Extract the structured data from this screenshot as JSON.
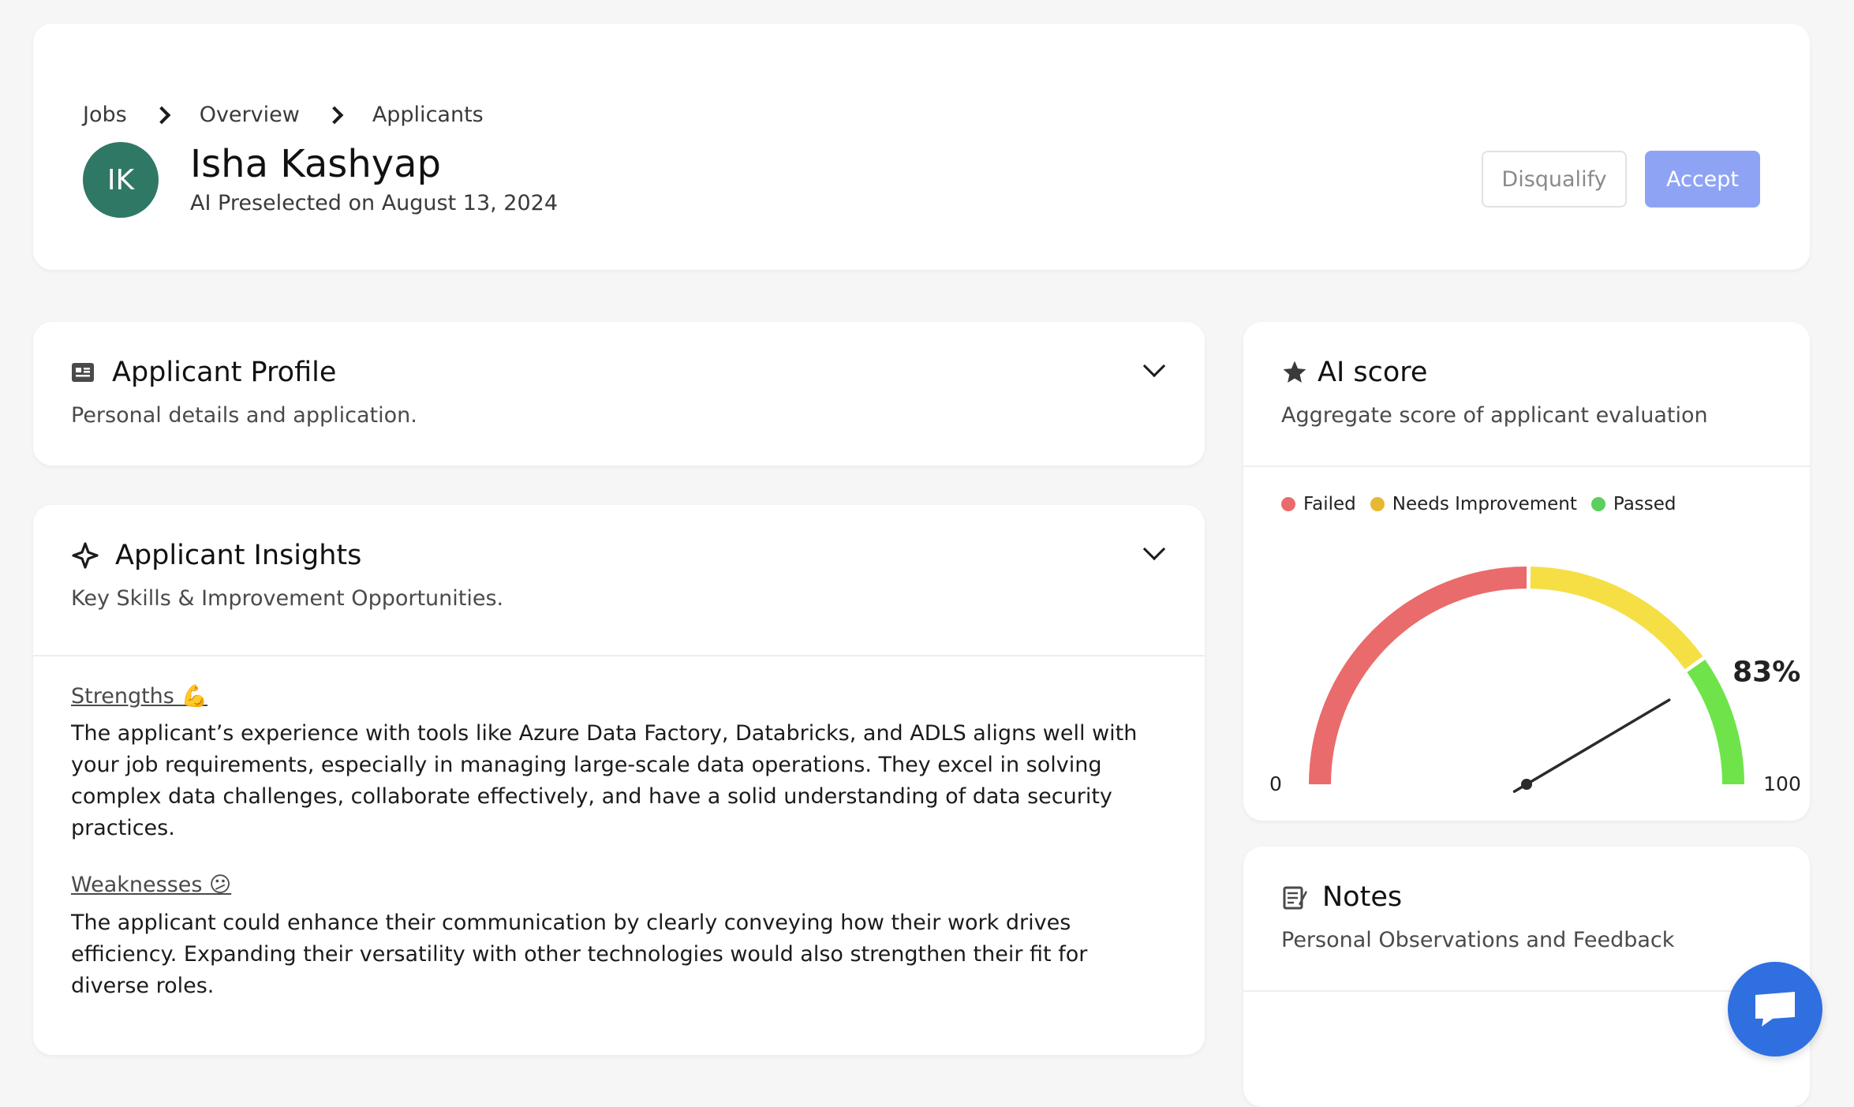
{
  "breadcrumb": [
    "Jobs",
    "Overview",
    "Applicants"
  ],
  "applicant": {
    "initials": "IK",
    "name": "Isha Kashyap",
    "subtitle": "AI Preselected on August 13, 2024",
    "avatar_color": "#2f7866"
  },
  "actions": {
    "disqualify_label": "Disqualify",
    "accept_label": "Accept",
    "accept_color": "#8fa3f5"
  },
  "profile_card": {
    "icon": "id-card-icon",
    "title": "Applicant Profile",
    "subtitle": "Personal details and application."
  },
  "insights_card": {
    "icon": "sparkle-icon",
    "title": "Applicant Insights",
    "subtitle": "Key Skills & Improvement Opportunities.",
    "strengths_title": "Strengths 💪",
    "strengths_text": "The applicant’s experience with tools like Azure Data Factory, Databricks, and ADLS aligns well with your job requirements, especially in managing large-scale data operations. They excel in solving complex data challenges, collaborate effectively, and have a solid understanding of data security practices.",
    "weaknesses_title": "Weaknesses 😕",
    "weaknesses_text": "The applicant could enhance their communication by clearly conveying how their work drives efficiency. Expanding their versatility with other technologies would also strengthen their fit for diverse roles."
  },
  "score_card": {
    "icon": "star-icon",
    "title": "AI score",
    "subtitle": "Aggregate score of applicant evaluation",
    "legend": [
      {
        "label": "Failed",
        "color": "#ea6b6b"
      },
      {
        "label": "Needs Improvement",
        "color": "#e6b833"
      },
      {
        "label": "Passed",
        "color": "#5ccf5c"
      }
    ],
    "gauge": {
      "value": 83,
      "value_label": "83%",
      "min_label": "0",
      "max_label": "100",
      "min": 0,
      "max": 100,
      "bands": [
        {
          "from": 0,
          "to": 50,
          "color": "#ea6b6b"
        },
        {
          "from": 50,
          "to": 80,
          "color": "#f5df45"
        },
        {
          "from": 80,
          "to": 100,
          "color": "#6fe44a"
        }
      ]
    }
  },
  "notes_card": {
    "icon": "notepad-icon",
    "title": "Notes",
    "subtitle": "Personal Observations and Feedback"
  },
  "chat_fab": {
    "icon": "chat-bubble-icon",
    "color": "#2f6fe0"
  }
}
